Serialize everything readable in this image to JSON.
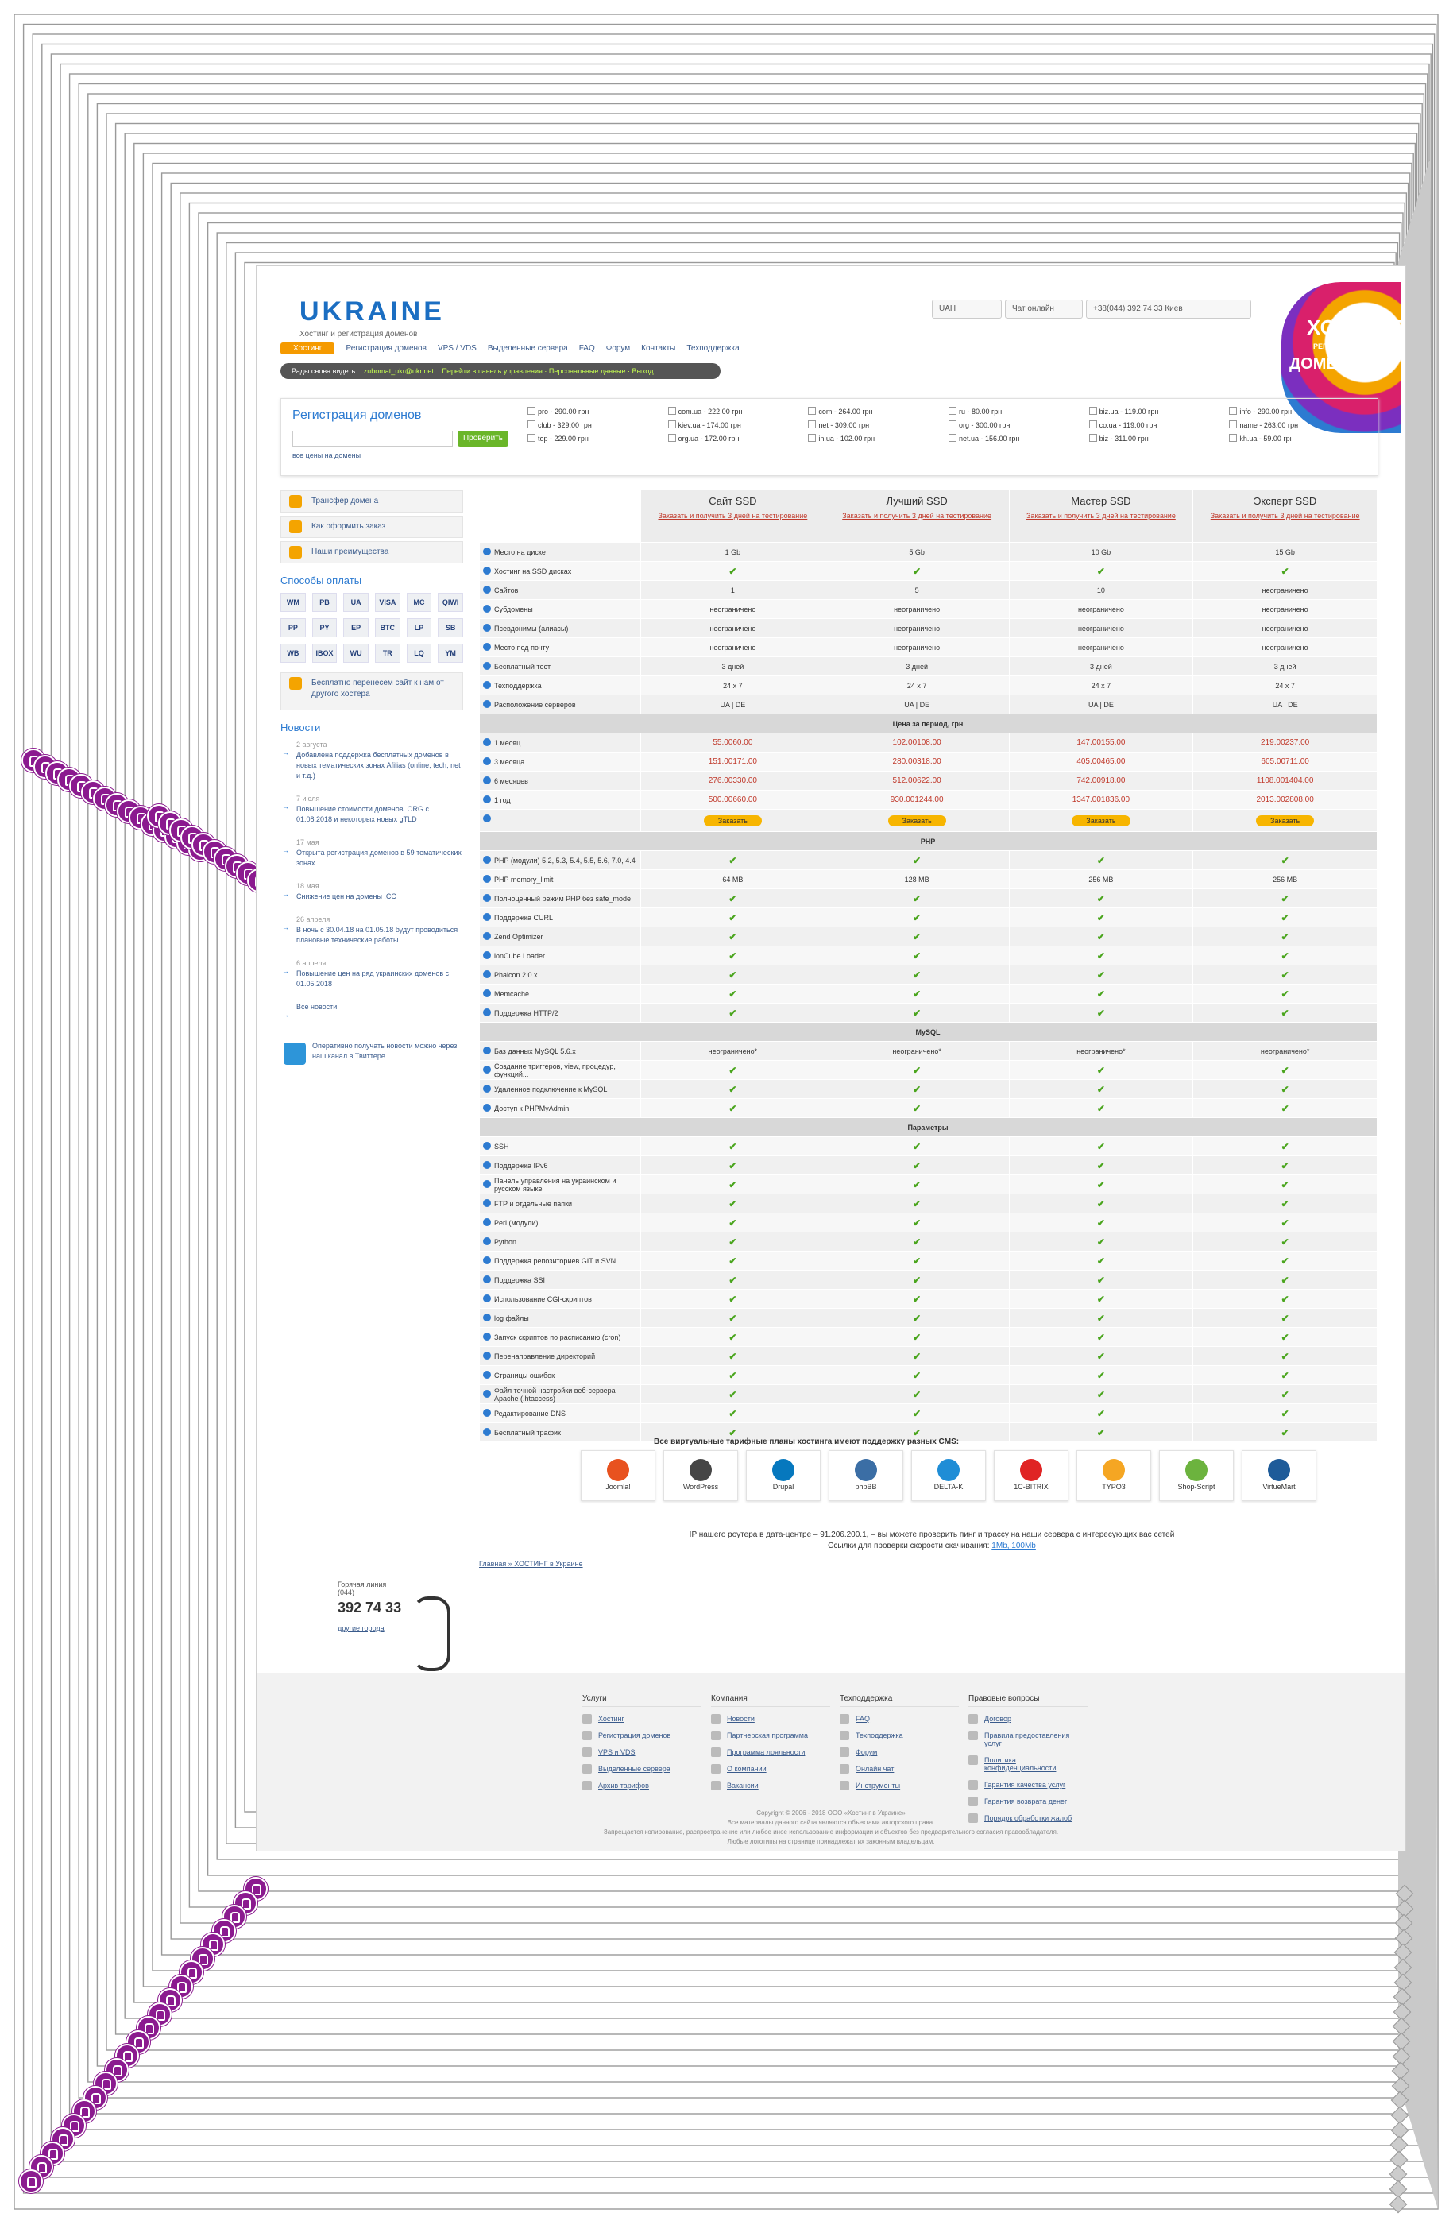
{
  "header": {
    "logo": "UKRAINE",
    "logo_tagline": "Хостинг и регистрация доменов",
    "currency": "UAH",
    "chat": "Чат онлайн",
    "phone": "+38(044) 392 74 33 Киев",
    "badge_line1": "ХОСТИНГ",
    "badge_line2": "РЕГИСТРАЦИЯ",
    "badge_line3": "ДОМЕНОВ"
  },
  "nav": [
    "Хостинг",
    "Регистрация доменов",
    "VPS / VDS",
    "Выделенные сервера",
    "FAQ",
    "Форум",
    "Контакты",
    "Техподдержка"
  ],
  "userbar": {
    "text": "Рады снова видеть",
    "user": "zubomat_ukr@ukr.net",
    "links": "Перейти в панель управления · Персональные данные · Выход"
  },
  "domains": {
    "title": "Регистрация доменов",
    "button": "Проверить",
    "all_prices": "все цены на домены",
    "zones": [
      "pro - 290.00 грн",
      "com.ua - 222.00 грн",
      "com - 264.00 грн",
      "ru - 80.00 грн",
      "biz.ua - 119.00 грн",
      "info - 290.00 грн",
      "club - 329.00 грн",
      "kiev.ua - 174.00 грн",
      "net - 309.00 грн",
      "org - 300.00 грн",
      "co.ua - 119.00 грн",
      "name - 263.00 грн",
      "top - 229.00 грн",
      "org.ua - 172.00 грн",
      "in.ua - 102.00 грн",
      "net.ua - 156.00 грн",
      "biz - 311.00 грн",
      "kh.ua - 59.00 грн"
    ]
  },
  "sidebar": {
    "items": [
      "Трансфер домена",
      "Как оформить заказ",
      "Наши преимущества"
    ],
    "payments_title": "Способы оплаты",
    "payments": [
      "WM",
      "PB",
      "UA",
      "VISA",
      "MC",
      "QIWI",
      "PP",
      "PY",
      "EP",
      "BTC",
      "LP",
      "SB",
      "WB",
      "IBOX",
      "WU",
      "TR",
      "LQ",
      "YM"
    ],
    "transfer_promo": "Бесплатно перенесем сайт к нам от другого хостера",
    "news_title": "Новости",
    "news": [
      {
        "date": "2 августа",
        "title": "Добавлена поддержка бесплатных доменов в новых тематических зонах Afilias (online, tech, net и т.д.)"
      },
      {
        "date": "7 июля",
        "title": "Повышение стоимости доменов .ORG с 01.08.2018 и некоторых новых gTLD"
      },
      {
        "date": "17 мая",
        "title": "Открыта регистрация доменов в 59 тематических зонах"
      },
      {
        "date": "18 мая",
        "title": "Снижение цен на домены .CC"
      },
      {
        "date": "26 апреля",
        "title": "В ночь с 30.04.18 на 01.05.18 будут проводиться плановые технические работы"
      },
      {
        "date": "6 апреля",
        "title": "Повышение цен на ряд украинских доменов с 01.05.2018"
      }
    ],
    "all_news": "Все новости",
    "twitter": "Оперативно получать новости можно через наш канал в Твиттере"
  },
  "plans": {
    "columns": [
      "Сайт SSD",
      "Лучший SSD",
      "Мастер SSD",
      "Эксперт SSD"
    ],
    "trial": "Заказать и получить 3 дней на тестирование",
    "order": "Заказать",
    "rows": [
      {
        "label": "Место на диске",
        "v": [
          "1 Gb",
          "5 Gb",
          "10 Gb",
          "15 Gb"
        ]
      },
      {
        "label": "Хостинг на SSD дисках",
        "v": [
          "✔",
          "✔",
          "✔",
          "✔"
        ]
      },
      {
        "label": "Сайтов",
        "v": [
          "1",
          "5",
          "10",
          "неограничено"
        ]
      },
      {
        "label": "Субдомены",
        "v": [
          "неограничено",
          "неограничено",
          "неограничено",
          "неограничено"
        ]
      },
      {
        "label": "Псевдонимы (алиасы)",
        "v": [
          "неограничено",
          "неограничено",
          "неограничено",
          "неограничено"
        ]
      },
      {
        "label": "Место под почту",
        "v": [
          "неограничено",
          "неограничено",
          "неограничено",
          "неограничено"
        ]
      },
      {
        "label": "Бесплатный тест",
        "v": [
          "3 дней",
          "3 дней",
          "3 дней",
          "3 дней"
        ]
      },
      {
        "label": "Техподдержка",
        "v": [
          "24 x 7",
          "24 x 7",
          "24 x 7",
          "24 x 7"
        ]
      },
      {
        "label": "Расположение серверов",
        "v": [
          "UA | DE",
          "UA | DE",
          "UA | DE",
          "UA | DE"
        ]
      },
      {
        "section": "Цена за период, грн"
      },
      {
        "label": "1 месяц",
        "price": [
          [
            "55.00",
            "60.00"
          ],
          [
            "102.00",
            "108.00"
          ],
          [
            "147.00",
            "155.00"
          ],
          [
            "219.00",
            "237.00"
          ]
        ]
      },
      {
        "label": "3 месяца",
        "price": [
          [
            "151.00",
            "171.00"
          ],
          [
            "280.00",
            "318.00"
          ],
          [
            "405.00",
            "465.00"
          ],
          [
            "605.00",
            "711.00"
          ]
        ]
      },
      {
        "label": "6 месяцев",
        "price": [
          [
            "276.00",
            "330.00"
          ],
          [
            "512.00",
            "622.00"
          ],
          [
            "742.00",
            "918.00"
          ],
          [
            "1108.00",
            "1404.00"
          ]
        ]
      },
      {
        "label": "1 год",
        "price": [
          [
            "500.00",
            "660.00"
          ],
          [
            "930.00",
            "1244.00"
          ],
          [
            "1347.00",
            "1836.00"
          ],
          [
            "2013.00",
            "2808.00"
          ]
        ]
      },
      {
        "order": true
      },
      {
        "section": "PHP"
      },
      {
        "label": "PHP (модули) 5.2, 5.3, 5.4, 5.5, 5.6, 7.0, 4.4",
        "v": [
          "✔",
          "✔",
          "✔",
          "✔"
        ]
      },
      {
        "label": "PHP memory_limit",
        "v": [
          "64 MB",
          "128 MB",
          "256 MB",
          "256 MB"
        ]
      },
      {
        "label": "Полноценный режим PHP без safe_mode",
        "v": [
          "✔",
          "✔",
          "✔",
          "✔"
        ]
      },
      {
        "label": "Поддержка CURL",
        "v": [
          "✔",
          "✔",
          "✔",
          "✔"
        ]
      },
      {
        "label": "Zend Optimizer",
        "v": [
          "✔",
          "✔",
          "✔",
          "✔"
        ]
      },
      {
        "label": "ionCube Loader",
        "v": [
          "✔",
          "✔",
          "✔",
          "✔"
        ]
      },
      {
        "label": "Phalcon 2.0.x",
        "v": [
          "✔",
          "✔",
          "✔",
          "✔"
        ]
      },
      {
        "label": "Memcache",
        "v": [
          "✔",
          "✔",
          "✔",
          "✔"
        ]
      },
      {
        "label": "Поддержка HTTP/2",
        "v": [
          "✔",
          "✔",
          "✔",
          "✔"
        ]
      },
      {
        "section": "MySQL"
      },
      {
        "label": "Баз данных MySQL 5.6.x",
        "v": [
          "неограничено*",
          "неограничено*",
          "неограничено*",
          "неограничено*"
        ]
      },
      {
        "label": "Создание триггеров, view, процедур, функций...",
        "v": [
          "✔",
          "✔",
          "✔",
          "✔"
        ]
      },
      {
        "label": "Удаленное подключение к MySQL",
        "v": [
          "✔",
          "✔",
          "✔",
          "✔"
        ]
      },
      {
        "label": "Доступ к PHPMyAdmin",
        "v": [
          "✔",
          "✔",
          "✔",
          "✔"
        ]
      },
      {
        "section": "Параметры"
      },
      {
        "label": "SSH",
        "v": [
          "✔",
          "✔",
          "✔",
          "✔"
        ]
      },
      {
        "label": "Поддержка IPv6",
        "v": [
          "✔",
          "✔",
          "✔",
          "✔"
        ]
      },
      {
        "label": "Панель управления на украинском и русском языке",
        "v": [
          "✔",
          "✔",
          "✔",
          "✔"
        ]
      },
      {
        "label": "FTP и отдельные папки",
        "v": [
          "✔",
          "✔",
          "✔",
          "✔"
        ]
      },
      {
        "label": "Perl (модули)",
        "v": [
          "✔",
          "✔",
          "✔",
          "✔"
        ]
      },
      {
        "label": "Python",
        "v": [
          "✔",
          "✔",
          "✔",
          "✔"
        ]
      },
      {
        "label": "Поддержка репозиториев GIT и SVN",
        "v": [
          "✔",
          "✔",
          "✔",
          "✔"
        ]
      },
      {
        "label": "Поддержка SSI",
        "v": [
          "✔",
          "✔",
          "✔",
          "✔"
        ]
      },
      {
        "label": "Использование CGI-скриптов",
        "v": [
          "✔",
          "✔",
          "✔",
          "✔"
        ]
      },
      {
        "label": "log файлы",
        "v": [
          "✔",
          "✔",
          "✔",
          "✔"
        ]
      },
      {
        "label": "Запуск скриптов по расписанию (cron)",
        "v": [
          "✔",
          "✔",
          "✔",
          "✔"
        ]
      },
      {
        "label": "Перенаправление директорий",
        "v": [
          "✔",
          "✔",
          "✔",
          "✔"
        ]
      },
      {
        "label": "Страницы ошибок",
        "v": [
          "✔",
          "✔",
          "✔",
          "✔"
        ]
      },
      {
        "label": "Файл точной настройки веб-сервера Apache (.htaccess)",
        "v": [
          "✔",
          "✔",
          "✔",
          "✔"
        ]
      },
      {
        "label": "Редактирование DNS",
        "v": [
          "✔",
          "✔",
          "✔",
          "✔"
        ]
      },
      {
        "label": "Бесплатный трафик",
        "v": [
          "✔",
          "✔",
          "✔",
          "✔"
        ]
      }
    ]
  },
  "cms_title": "Все виртуальные тарифные планы хостинга имеют поддержку разных CMS:",
  "cms": [
    "Joomla!",
    "WordPress",
    "Drupal",
    "phpBB",
    "DELTA-K",
    "1C-BITRIX",
    "TYPO3",
    "Shop-Script",
    "VirtueMart"
  ],
  "router_text": "IP нашего роутера в дата-центре – 91.206.200.1, – вы можете проверить пинг и трассу на наши сервера с интересующих вас сетей",
  "speed_text": "Ссылки для проверки скорости скачивания:",
  "speed_links": "1Mb, 100Mb",
  "breadcrumbs": "Главная » ХОСТИНГ в Украине",
  "hotline": {
    "title": "Горячая линия",
    "city": "(044)",
    "number": "392 74 33",
    "link": "другие города"
  },
  "footer": {
    "cols": [
      {
        "title": "Услуги",
        "items": [
          "Хостинг",
          "Регистрация доменов",
          "VPS и VDS",
          "Выделенные сервера",
          "Архив тарифов"
        ]
      },
      {
        "title": "Компания",
        "items": [
          "Новости",
          "Партнерская программа",
          "Программа лояльности",
          "О компании",
          "Вакансии"
        ]
      },
      {
        "title": "Техподдержка",
        "items": [
          "FAQ",
          "Техподдержка",
          "Форум",
          "Онлайн чат",
          "Инструменты"
        ]
      },
      {
        "title": "Правовые вопросы",
        "items": [
          "Договор",
          "Правила предоставления услуг",
          "Политика конфиденциальности",
          "Гарантия качества услуг",
          "Гарантия возврата денег",
          "Порядок обработки жалоб"
        ]
      }
    ],
    "copyright": "Copyright © 2006 - 2018 ООО «Хостинг в Украине»",
    "legal1": "Все материалы данного сайта являются объектами авторского права.",
    "legal2": "Запрещается копирование, распространение или любое иное использование информации и объектов без предварительного согласия правообладателя.",
    "legal3": "Любые логотипы на странице принадлежат их законным владельцам."
  }
}
